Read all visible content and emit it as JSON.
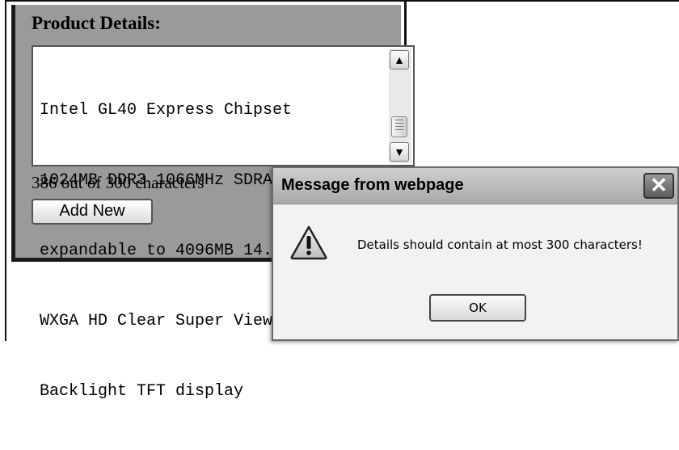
{
  "panel": {
    "title": "Product Details:",
    "details_lines": [
      "Intel GL40 Express Chipset",
      "1024MB DDR3 1066MHz SDRAM",
      "expandable to 4096MB 14.0\"",
      "WXGA HD Clear Super View LED",
      "Backlight TFT display"
    ],
    "counter_text": "386 out of 300 characters",
    "add_button_label": "Add New"
  },
  "dialog": {
    "title": "Message from webpage",
    "message": "Details should contain at most 300 characters!",
    "ok_label": "OK",
    "close_glyph": "✕",
    "icon": "warning-icon"
  },
  "scrollbar": {
    "up_glyph": "▲",
    "down_glyph": "▼"
  }
}
